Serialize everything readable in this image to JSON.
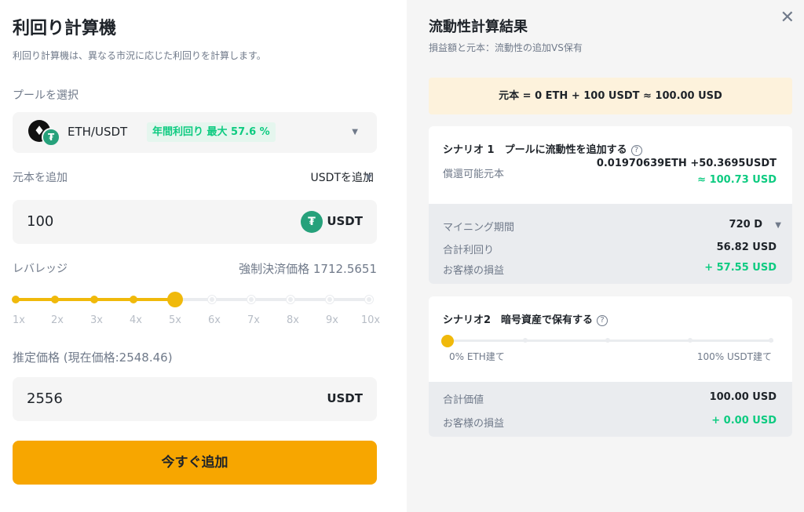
{
  "calculator": {
    "title": "利回り計算機",
    "subtitle": "利回り計算機は、異なる市況に応じた利回りを計算します。",
    "pool_label": "プールを選択",
    "pool_name": "ETH/USDT",
    "pool_apy_badge": "年間利回り 最大 57.6 %",
    "principal_label": "元本を追加",
    "principal_mode": "USDTを追加",
    "principal_value": "100",
    "principal_unit": "USDT",
    "leverage_label": "レバレッジ",
    "liquidation_price": "強制決済価格 1712.5651",
    "leverage_ticks": [
      "1x",
      "2x",
      "3x",
      "4x",
      "5x",
      "6x",
      "7x",
      "8x",
      "9x",
      "10x"
    ],
    "leverage_selected_index": 4,
    "price_label": "推定価格 (現在価格:2548.46)",
    "price_value": "2556",
    "price_unit": "USDT",
    "cta_label": "今すぐ追加"
  },
  "results": {
    "title": "流動性計算結果",
    "subtitle": "損益額と元本：流動性の追加VS保有",
    "principal_summary": "元本 = 0 ETH + 100 USDT ≈ 100.00 USD",
    "scenario1": {
      "title": "シナリオ 1　プールに流動性を追加する",
      "redeemable_label": "償還可能元本",
      "redeemable_value": "0.01970639ETH +50.3695USDT",
      "redeemable_usd": "≈ 100.73 USD",
      "mining_period_label": "マイニング期間",
      "mining_period_value": "720 D",
      "total_yield_label": "合計利回り",
      "total_yield_value": "56.82 USD",
      "pnl_label": "お客様の損益",
      "pnl_value": "+ 57.55 USD"
    },
    "scenario2": {
      "title": "シナリオ2　暗号資産で保有する",
      "slider_left_label": "0% ETH建て",
      "slider_right_label": "100% USDT建て",
      "slider_position": 0,
      "total_value_label": "合計価値",
      "total_value": "100.00 USD",
      "pnl_label": "お客様の損益",
      "pnl_value": "+ 0.00 USD"
    }
  },
  "icons": {
    "close": "close-icon",
    "help": "help-icon",
    "eth": "eth-coin-icon",
    "usdt": "usdt-coin-icon",
    "caret": "caret-down-icon"
  },
  "colors": {
    "accent": "#f7a600",
    "positive": "#0ecb81",
    "usdt": "#26a17b"
  }
}
